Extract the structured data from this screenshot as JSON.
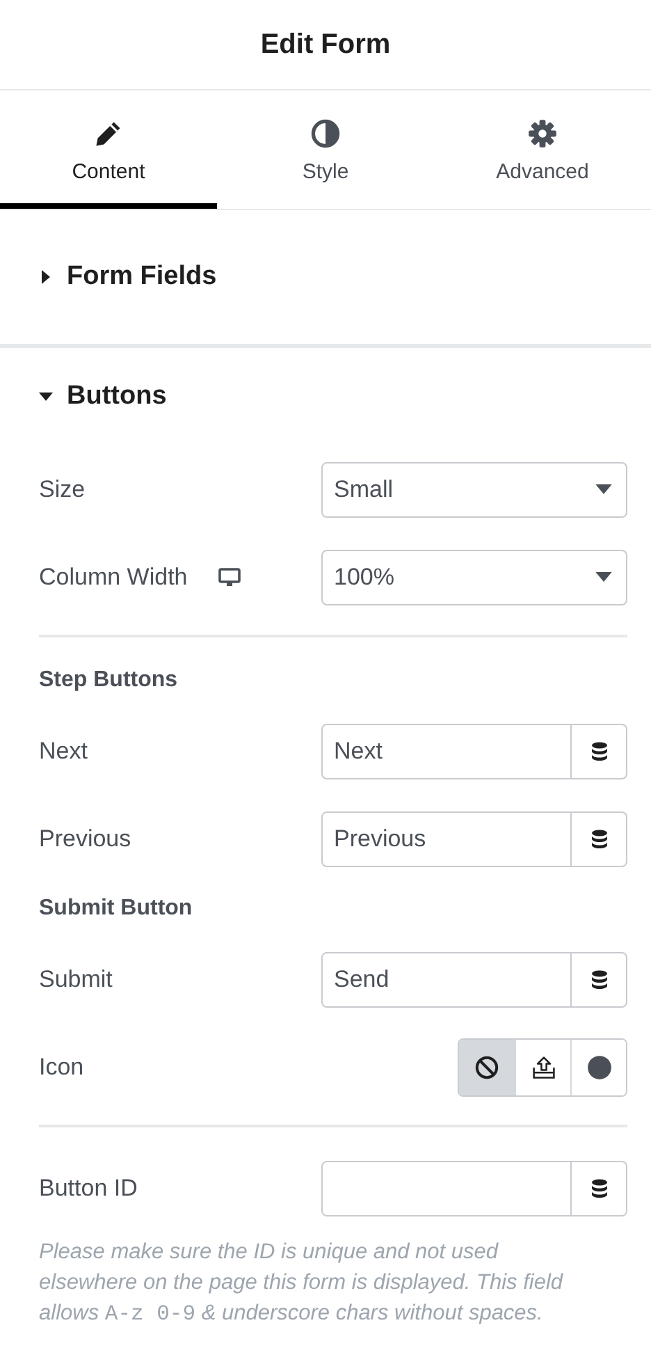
{
  "title": "Edit Form",
  "tabs": [
    {
      "label": "Content",
      "selected": true
    },
    {
      "label": "Style",
      "selected": false
    },
    {
      "label": "Advanced",
      "selected": false
    }
  ],
  "sections": [
    {
      "title": "Form Fields",
      "expanded": false
    },
    {
      "title": "Buttons",
      "expanded": true,
      "controls": [
        {
          "kind": "select",
          "label": "Size",
          "value": "Small",
          "responsive": false
        },
        {
          "kind": "select",
          "label": "Column Width",
          "value": "100%",
          "responsive": true
        },
        {
          "kind": "divider"
        },
        {
          "kind": "heading",
          "label": "Step Buttons"
        },
        {
          "kind": "text",
          "label": "Next",
          "value": "Next"
        },
        {
          "kind": "text",
          "label": "Previous",
          "value": "Previous"
        },
        {
          "kind": "heading",
          "label": "Submit Button"
        },
        {
          "kind": "text",
          "label": "Submit",
          "value": "Send"
        },
        {
          "kind": "choose",
          "label": "Icon",
          "options": [
            {
              "selected": true
            },
            {
              "selected": false
            },
            {
              "selected": false
            }
          ]
        },
        {
          "kind": "divider"
        },
        {
          "kind": "text",
          "label": "Button ID"
        },
        {
          "kind": "help",
          "parts": [
            {
              "kind": "plain",
              "text": "Please make sure the ID is unique and not used elsewhere on the page this form is displayed. This field allows "
            },
            {
              "kind": "code",
              "text": "A-z 0-9"
            },
            {
              "kind": "plain",
              "text": " & underscore chars without spaces."
            }
          ]
        }
      ]
    }
  ]
}
